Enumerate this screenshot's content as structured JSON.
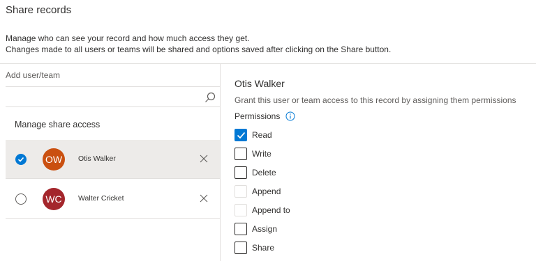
{
  "dialog": {
    "title": "Share records",
    "description_line1": "Manage who can see your record and how much access they get.",
    "description_line2": "Changes made to all users or teams will be shared and options saved after clicking on the Share button."
  },
  "left_pane": {
    "add_label": "Add user/team",
    "search_value": "",
    "manage_label": "Manage share access",
    "users": [
      {
        "initials": "OW",
        "name": "Otis Walker",
        "avatar_color": "#ca5010",
        "selected": true
      },
      {
        "initials": "WC",
        "name": "Walter Cricket",
        "avatar_color": "#a4262c",
        "selected": false
      }
    ]
  },
  "right_pane": {
    "user_name": "Otis Walker",
    "grant_text": "Grant this user or team access to this record by assigning them permissions",
    "permissions_label": "Permissions",
    "permissions": [
      {
        "label": "Read",
        "checked": true,
        "disabled": false
      },
      {
        "label": "Write",
        "checked": false,
        "disabled": false
      },
      {
        "label": "Delete",
        "checked": false,
        "disabled": false
      },
      {
        "label": "Append",
        "checked": false,
        "disabled": true
      },
      {
        "label": "Append to",
        "checked": false,
        "disabled": true
      },
      {
        "label": "Assign",
        "checked": false,
        "disabled": false
      },
      {
        "label": "Share",
        "checked": false,
        "disabled": false
      }
    ]
  },
  "colors": {
    "accent": "#0078d4",
    "divider": "#e1dfdd",
    "selected_row": "#edebe9"
  }
}
